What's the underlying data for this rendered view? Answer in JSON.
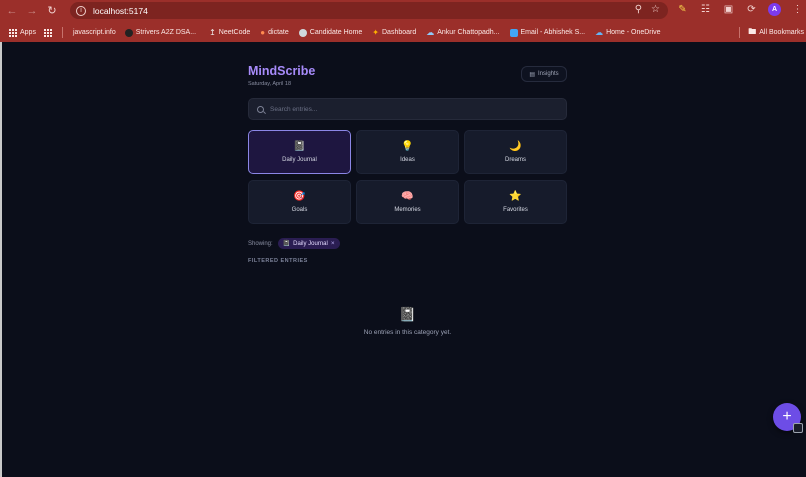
{
  "browser": {
    "url": "localhost:5174",
    "avatar_letter": "A",
    "bookmarks": [
      {
        "label": "Apps",
        "icon": "apps-grid-icon"
      },
      {
        "label": "javascript.info",
        "icon": "js-icon",
        "color": "#f5a623"
      },
      {
        "label": "Strivers A2Z DSA...",
        "icon": "striver-icon",
        "color": "#222222"
      },
      {
        "label": "NeetCode",
        "icon": "neetcode-icon",
        "color": "#e8e8e8"
      },
      {
        "label": "dictate",
        "icon": "mic-icon",
        "color": "#ff7043"
      },
      {
        "label": "Candidate Home",
        "icon": "candidate-icon",
        "color": "#cfd8dc"
      },
      {
        "label": "Dashboard",
        "icon": "dashboard-icon",
        "color": "#ffb300"
      },
      {
        "label": "Ankur Chattopadh...",
        "icon": "cloud-icon",
        "color": "#90caf9"
      },
      {
        "label": "Email - Abhishek S...",
        "icon": "outlook-icon",
        "color": "#42a5f5"
      },
      {
        "label": "Home - OneDrive",
        "icon": "onedrive-icon",
        "color": "#64b5f6"
      }
    ],
    "all_bookmarks_label": "All Bookmarks"
  },
  "app": {
    "brand": "MindScribe",
    "date": "Saturday, April 18",
    "insights_label": "Insights",
    "search_placeholder": "Search entries...",
    "categories": [
      {
        "label": "Daily Journal",
        "icon": "notebook-icon",
        "glyph": "📓",
        "active": true
      },
      {
        "label": "Ideas",
        "icon": "lightbulb-icon",
        "glyph": "💡",
        "active": false
      },
      {
        "label": "Dreams",
        "icon": "moon-icon",
        "glyph": "🌙",
        "active": false
      },
      {
        "label": "Goals",
        "icon": "target-icon",
        "glyph": "🎯",
        "active": false
      },
      {
        "label": "Memories",
        "icon": "brain-icon",
        "glyph": "🧠",
        "active": false
      },
      {
        "label": "Favorites",
        "icon": "star-icon",
        "glyph": "⭐",
        "active": false
      }
    ],
    "showing_label": "Showing:",
    "filter_chip": {
      "glyph": "📓",
      "label": "Daily Journal",
      "close": "×"
    },
    "section_title": "FILTERED ENTRIES",
    "empty_glyph": "📓",
    "empty_message": "No entries in this category yet.",
    "fab_label": "+",
    "accent_color": "#a78bfa"
  }
}
